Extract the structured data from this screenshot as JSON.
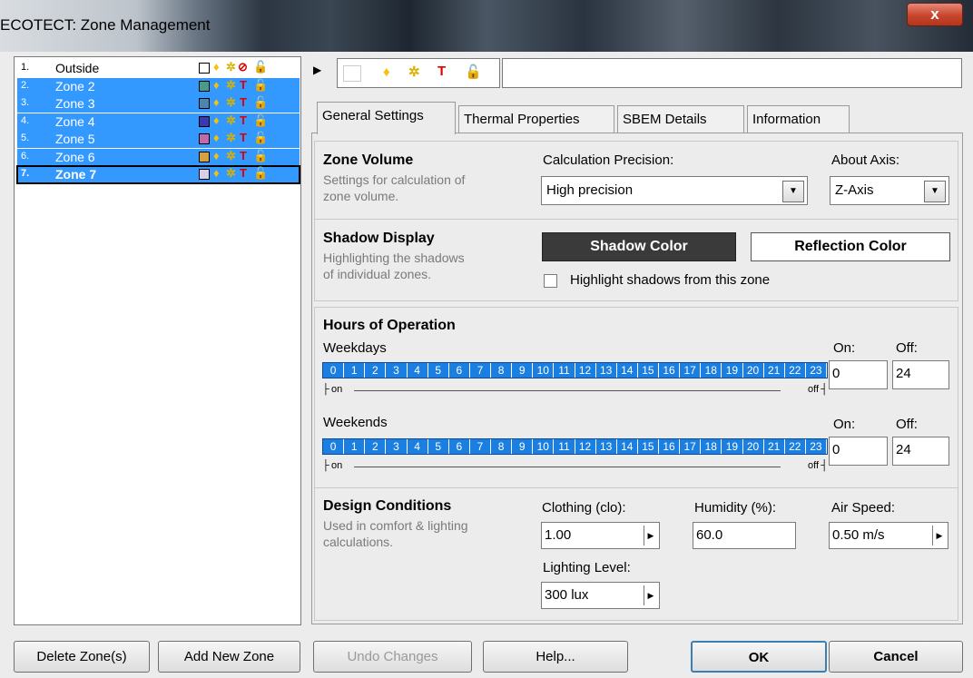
{
  "window": {
    "title": "ECOTECT: Zone Management",
    "close_glyph": "x"
  },
  "zones": [
    {
      "num": "1.",
      "name": "Outside",
      "swatch": "#ffffff",
      "status": "no-zone-icon",
      "status_glyph": "⊘"
    },
    {
      "num": "2.",
      "name": "Zone 2",
      "swatch": "#4a9a8a",
      "status": "T",
      "status_glyph": "T"
    },
    {
      "num": "3.",
      "name": "Zone 3",
      "swatch": "#4a86b0",
      "status": "T",
      "status_glyph": "T"
    },
    {
      "num": "4.",
      "name": "Zone 4",
      "swatch": "#3a3ab0",
      "status": "T",
      "status_glyph": "T"
    },
    {
      "num": "5.",
      "name": "Zone 5",
      "swatch": "#c06aa8",
      "status": "T",
      "status_glyph": "T"
    },
    {
      "num": "6.",
      "name": "Zone 6",
      "swatch": "#d4a040",
      "status": "T",
      "status_glyph": "T"
    },
    {
      "num": "7.",
      "name": "Zone 7",
      "swatch": "#d8d0e8",
      "status": "T",
      "status_glyph": "T"
    }
  ],
  "bottom": {
    "delete": "Delete Zone(s)",
    "add": "Add New Zone",
    "undo": "Undo Changes",
    "help": "Help...",
    "ok": "OK",
    "cancel": "Cancel"
  },
  "tabs": [
    "General Settings",
    "Thermal Properties",
    "SBEM Details",
    "Information"
  ],
  "zone_volume": {
    "title": "Zone Volume",
    "desc1": "Settings for calculation of",
    "desc2": "zone volume.",
    "precision_label": "Calculation Precision:",
    "precision_value": "High precision",
    "axis_label": "About Axis:",
    "axis_value": "Z-Axis"
  },
  "shadow": {
    "title": "Shadow Display",
    "desc1": "Highlighting the shadows",
    "desc2": "of individual zones.",
    "shadow_btn": "Shadow Color",
    "reflection_btn": "Reflection Color",
    "highlight_label": "Highlight shadows from this zone"
  },
  "hours": {
    "title": "Hours of Operation",
    "weekdays": "Weekdays",
    "weekends": "Weekends",
    "on_label": "On:",
    "off_label": "Off:",
    "weekdays_on": "0",
    "weekdays_off": "24",
    "weekends_on": "0",
    "weekends_off": "24",
    "bar_on": "on",
    "bar_off": "off",
    "hour_labels": [
      "0",
      "1",
      "2",
      "3",
      "4",
      "5",
      "6",
      "7",
      "8",
      "9",
      "10",
      "11",
      "12",
      "13",
      "14",
      "15",
      "16",
      "17",
      "18",
      "19",
      "20",
      "21",
      "22",
      "23"
    ]
  },
  "design": {
    "title": "Design Conditions",
    "desc1": "Used in comfort & lighting",
    "desc2": "calculations.",
    "clothing_label": "Clothing (clo):",
    "clothing_value": "1.00",
    "humidity_label": "Humidity (%):",
    "humidity_value": "60.0",
    "airspeed_label": "Air Speed:",
    "airspeed_value": "0.50 m/s",
    "lighting_label": "Lighting Level:",
    "lighting_value": "300 lux"
  }
}
